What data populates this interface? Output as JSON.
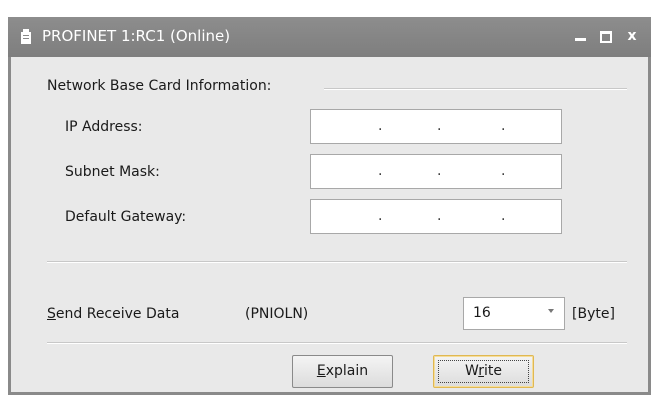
{
  "window": {
    "title": "PROFINET 1:RC1 (Online)",
    "controls": {
      "minimize": "minimize",
      "maximize": "maximize",
      "close": "x"
    }
  },
  "network": {
    "section_label": "Network Base Card Information:",
    "ip_address_label": "IP Address:",
    "subnet_mask_label": "Subnet Mask:",
    "default_gateway_label": "Default Gateway:",
    "ip_address": [
      "",
      "",
      "",
      ""
    ],
    "subnet_mask": [
      "",
      "",
      "",
      ""
    ],
    "default_gateway": [
      "",
      "",
      "",
      ""
    ],
    "dot": "."
  },
  "send_receive": {
    "label_first": "S",
    "label_rest": "end Receive Data",
    "param": "(PNIOLN)",
    "value": "16",
    "unit": "[Byte]"
  },
  "buttons": {
    "explain_mnemonic": "E",
    "explain_rest": "xplain",
    "write_prefix": "W",
    "write_mnemonic": "r",
    "write_rest": "ite"
  }
}
